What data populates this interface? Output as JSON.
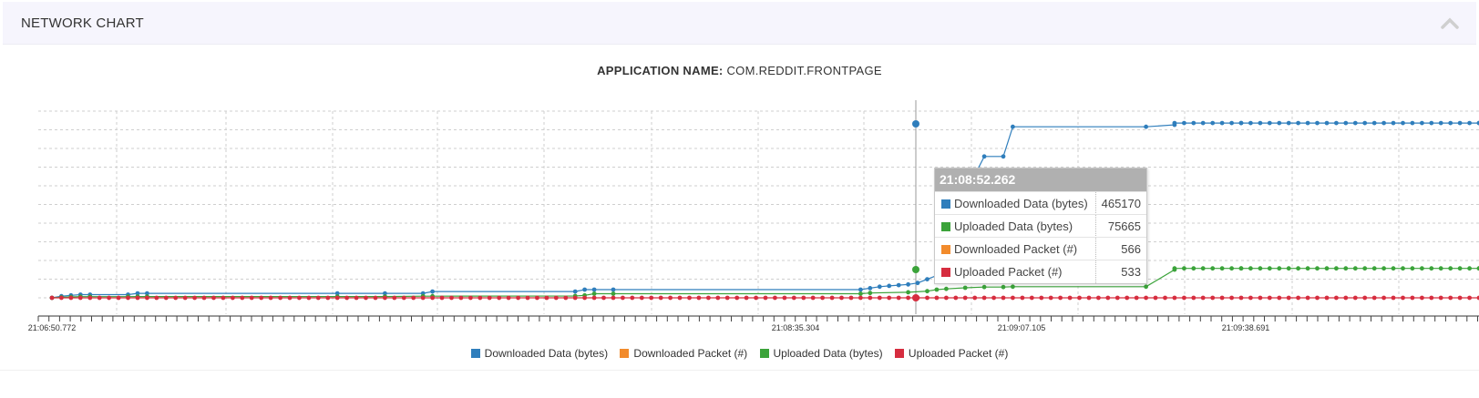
{
  "header": {
    "title": "NETWORK CHART",
    "collapse_icon": "chevron-up-icon"
  },
  "subtitle": {
    "label": "APPLICATION NAME:",
    "value": "COM.REDDIT.FRONTPAGE"
  },
  "tooltip": {
    "time": "21:08:52.262",
    "rows": [
      {
        "label": "Downloaded Data (bytes)",
        "value": "465170",
        "color": "#2f7ebc"
      },
      {
        "label": "Uploaded Data (bytes)",
        "value": "75665",
        "color": "#3ba33a"
      },
      {
        "label": "Downloaded Packet (#)",
        "value": "566",
        "color": "#f28b2c"
      },
      {
        "label": "Uploaded Packet (#)",
        "value": "533",
        "color": "#d62d3f"
      }
    ]
  },
  "chart_data": {
    "type": "line",
    "title": "APPLICATION NAME: COM.REDDIT.FRONTPAGE",
    "x_tick_labels": [
      "21:06:50.772",
      "21:08:35.304",
      "21:09:07.105",
      "21:09:38.691"
    ],
    "grid": true,
    "legend_position": "bottom",
    "series": [
      {
        "name": "Downloaded Data (bytes)",
        "color": "#2f7ebc",
        "x": [
          0,
          1,
          2,
          3,
          4,
          8,
          9,
          10,
          30,
          35,
          39,
          40,
          55,
          56,
          57,
          59,
          85,
          86,
          87,
          88,
          89,
          90,
          91,
          92,
          93,
          94,
          96,
          98,
          100,
          101,
          115,
          118,
          125,
          150
        ],
        "values": [
          0,
          4300,
          6500,
          8600,
          8600,
          8600,
          12000,
          12000,
          12000,
          12000,
          12000,
          17000,
          17000,
          22000,
          22000,
          22000,
          22000,
          26000,
          30000,
          32000,
          34000,
          36000,
          40000,
          50000,
          60000,
          100000,
          280000,
          380000,
          380000,
          460000,
          460000,
          465170,
          470000,
          470000
        ]
      },
      {
        "name": "Uploaded Data (bytes)",
        "color": "#3ba33a",
        "x": [
          0,
          1,
          2,
          3,
          4,
          8,
          9,
          10,
          30,
          35,
          39,
          40,
          55,
          56,
          57,
          59,
          85,
          86,
          90,
          92,
          93,
          94,
          96,
          98,
          100,
          101,
          115,
          118,
          125,
          150
        ],
        "values": [
          0,
          1500,
          2500,
          3200,
          3200,
          3200,
          3500,
          3500,
          3500,
          3500,
          4500,
          4500,
          5000,
          6500,
          11000,
          11000,
          11000,
          13000,
          15000,
          18000,
          22000,
          24000,
          27000,
          29000,
          29000,
          30000,
          30000,
          75665,
          79000,
          79000
        ]
      },
      {
        "name": "Downloaded Packet (#)",
        "color": "#f28b2c",
        "x": [
          0,
          150
        ],
        "values": [
          0,
          566
        ]
      },
      {
        "name": "Uploaded Packet (#)",
        "color": "#d62d3f",
        "x": [
          0,
          150
        ],
        "values": [
          0,
          533
        ]
      }
    ]
  },
  "legend": [
    {
      "label": "Downloaded Data (bytes)",
      "color": "#2f7ebc"
    },
    {
      "label": "Downloaded Packet (#)",
      "color": "#f28b2c"
    },
    {
      "label": "Uploaded Data (bytes)",
      "color": "#3ba33a"
    },
    {
      "label": "Uploaded Packet (#)",
      "color": "#d62d3f"
    }
  ]
}
